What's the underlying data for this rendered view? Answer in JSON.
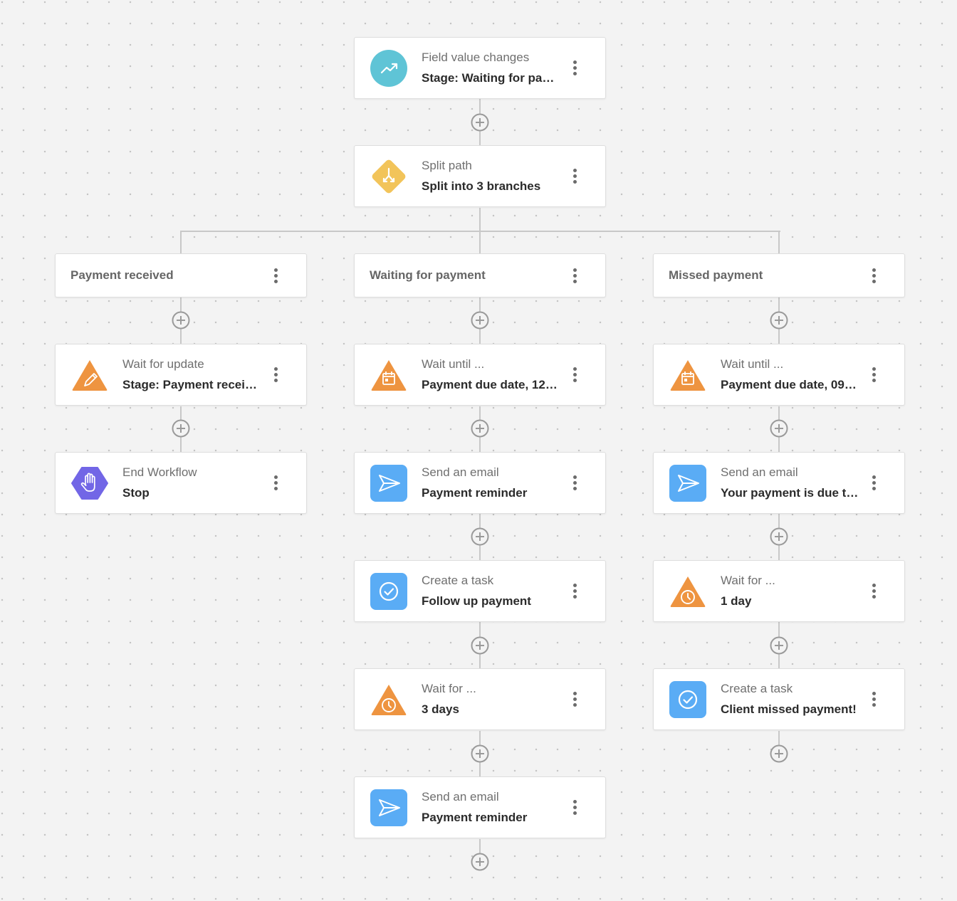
{
  "colors": {
    "canvas_bg": "#f3f3f3",
    "grid_dot": "#c4c4c4",
    "connector": "#c8c8c8",
    "trigger_teal": "#5fc4d6",
    "split_yellow": "#f2c45a",
    "wait_orange": "#ee9440",
    "end_purple": "#7266e6",
    "action_blue": "#5aacf5"
  },
  "trigger": {
    "icon": "trending-up-icon",
    "subtitle": "Field value changes",
    "title": "Stage: Waiting for pay…"
  },
  "split": {
    "icon": "split-path-icon",
    "subtitle": "Split path",
    "title": "Split into 3 branches"
  },
  "branches": [
    {
      "label": "Payment received",
      "steps": [
        {
          "icon": "pencil-icon",
          "subtitle": "Wait for update",
          "title": "Stage: Payment receiv…"
        },
        {
          "icon": "hand-stop-icon",
          "subtitle": "End Workflow",
          "title": "Stop"
        }
      ]
    },
    {
      "label": "Waiting for payment",
      "steps": [
        {
          "icon": "calendar-icon",
          "subtitle": "Wait until ...",
          "title": "Payment due date, 12:…"
        },
        {
          "icon": "send-icon",
          "subtitle": "Send an email",
          "title": "Payment reminder"
        },
        {
          "icon": "check-circle-icon",
          "subtitle": "Create a task",
          "title": "Follow up payment"
        },
        {
          "icon": "clock-icon",
          "subtitle": "Wait for ...",
          "title": "3 days"
        },
        {
          "icon": "send-icon",
          "subtitle": "Send an email",
          "title": "Payment reminder"
        }
      ]
    },
    {
      "label": "Missed payment",
      "steps": [
        {
          "icon": "calendar-icon",
          "subtitle": "Wait until ...",
          "title": "Payment due date, 09:…"
        },
        {
          "icon": "send-icon",
          "subtitle": "Send an email",
          "title": "Your payment is due t…"
        },
        {
          "icon": "clock-icon",
          "subtitle": "Wait for ...",
          "title": "1 day"
        },
        {
          "icon": "check-circle-icon",
          "subtitle": "Create a task",
          "title": "Client missed payment!"
        }
      ]
    }
  ]
}
